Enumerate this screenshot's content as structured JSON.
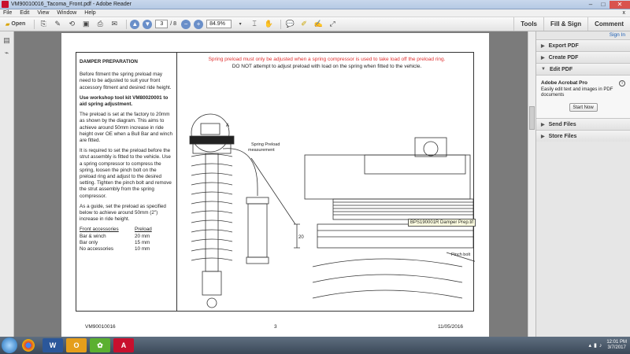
{
  "window": {
    "title": "VM90010016_Tacoma_Front.pdf - Adobe Reader",
    "minimize": "–",
    "maximize": "□",
    "close": "✕"
  },
  "menu": [
    "File",
    "Edit",
    "View",
    "Window",
    "Help"
  ],
  "menu_close": "x",
  "toolbar": {
    "open_label": "Open",
    "page_current": "3",
    "page_total": "/ 8",
    "zoom": "84.9%",
    "tools": "Tools",
    "fill_sign": "Fill & Sign",
    "comment": "Comment"
  },
  "document": {
    "heading": "DAMPER PREPARATION",
    "p1": "Before fitment the spring preload may need to be adjusted to suit your front accessory fitment and desired ride height.",
    "p2": "Use workshop tool kit VM80020001 to aid spring adjustment.",
    "p3": "The preload is set at the factory to 20mm as shown by the diagram. This aims to achieve around 50mm increase in ride height over OE when a Bull Bar and winch are fitted.",
    "p4": "It is required to set the preload before the strut assembly is fitted to the vehicle. Use a spring compressor to compress the spring, loosen the pinch bolt on the preload ring and adjust to the desired setting. Tighten the pinch bolt and remove the strut assembly from the spring compressor.",
    "p5": "As a guide, set the preload as specified below to achieve around 50mm (2\") increase in ride height.",
    "table_headers": [
      "Front accessories",
      "Preload"
    ],
    "table_rows": [
      [
        "Bar & winch",
        "20 mm"
      ],
      [
        "Bar only",
        "15 mm"
      ],
      [
        "No accessories",
        "10 mm"
      ]
    ],
    "warning_red": "Spring preload must only be adjusted when a spring compressor is used to take load off the preload ring.",
    "warning_black": "DO NOT attempt to adjust preload with load on the spring when fitted to the vehicle.",
    "diagram_label_a": "A",
    "diagram_label_preload": "Spring Preload",
    "diagram_label_measure": "measurement",
    "diagram_dim": "20",
    "diagram_pinch": "Pinch bolt",
    "footer_left": "VM90010016",
    "footer_center": "3",
    "footer_right": "11/05/2016"
  },
  "tooltip": "BPS190001R Damper Prep.tif",
  "right_panel": {
    "sign_in": "Sign In",
    "sections": [
      "Export PDF",
      "Create PDF",
      "Edit PDF"
    ],
    "promo_title": "Adobe Acrobat Pro",
    "promo_desc": "Easily edit text and images in PDF documents",
    "promo_button": "Start Now",
    "sections_bottom": [
      "Send Files",
      "Store Files"
    ]
  },
  "taskbar": {
    "time": "12:01 PM",
    "date": "3/7/2017"
  }
}
